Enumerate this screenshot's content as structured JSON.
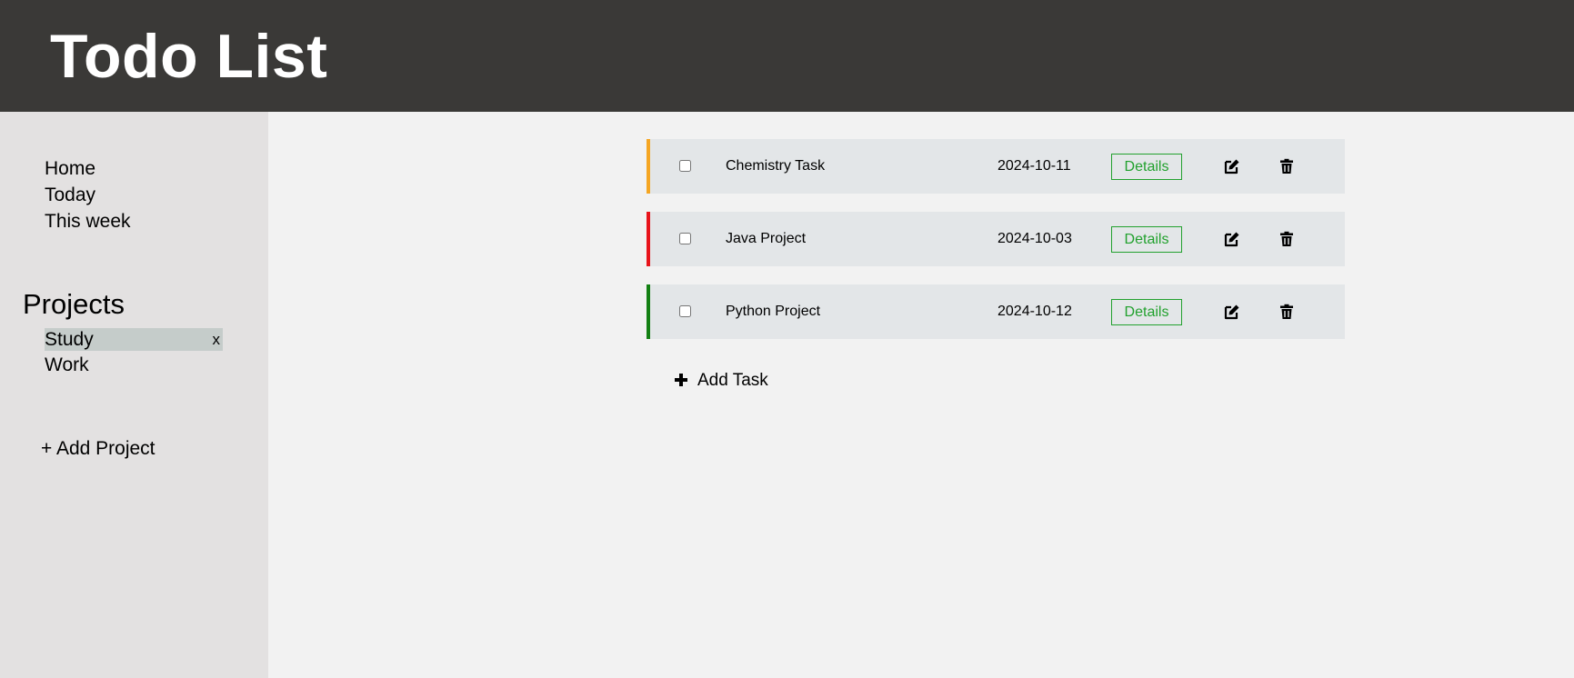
{
  "header": {
    "title": "Todo List"
  },
  "sidebar": {
    "nav": [
      {
        "label": "Home"
      },
      {
        "label": "Today"
      },
      {
        "label": "This week"
      }
    ],
    "projects_heading": "Projects",
    "projects": [
      {
        "label": "Study",
        "active": true,
        "delete_label": "x"
      },
      {
        "label": "Work",
        "active": false
      }
    ],
    "add_project_label": "+ Add Project"
  },
  "tasks": [
    {
      "name": "Chemistry Task",
      "date": "2024-10-11",
      "details_label": "Details",
      "priority_color": "#f5a623",
      "checked": false
    },
    {
      "name": "Java Project",
      "date": "2024-10-03",
      "details_label": "Details",
      "priority_color": "#e8141b",
      "checked": false
    },
    {
      "name": "Python Project",
      "date": "2024-10-12",
      "details_label": "Details",
      "priority_color": "#138013",
      "checked": false
    }
  ],
  "add_task_label": "Add Task",
  "icons": {
    "edit": "edit-icon",
    "delete": "trash-icon",
    "add": "plus-icon"
  },
  "colors": {
    "header_bg": "#3a3937",
    "sidebar_bg": "#e3e1e1",
    "main_bg": "#f2f2f2",
    "task_bg": "#e3e6e8",
    "details_green": "#22a12e",
    "active_project_bg": "#c5ccca"
  }
}
